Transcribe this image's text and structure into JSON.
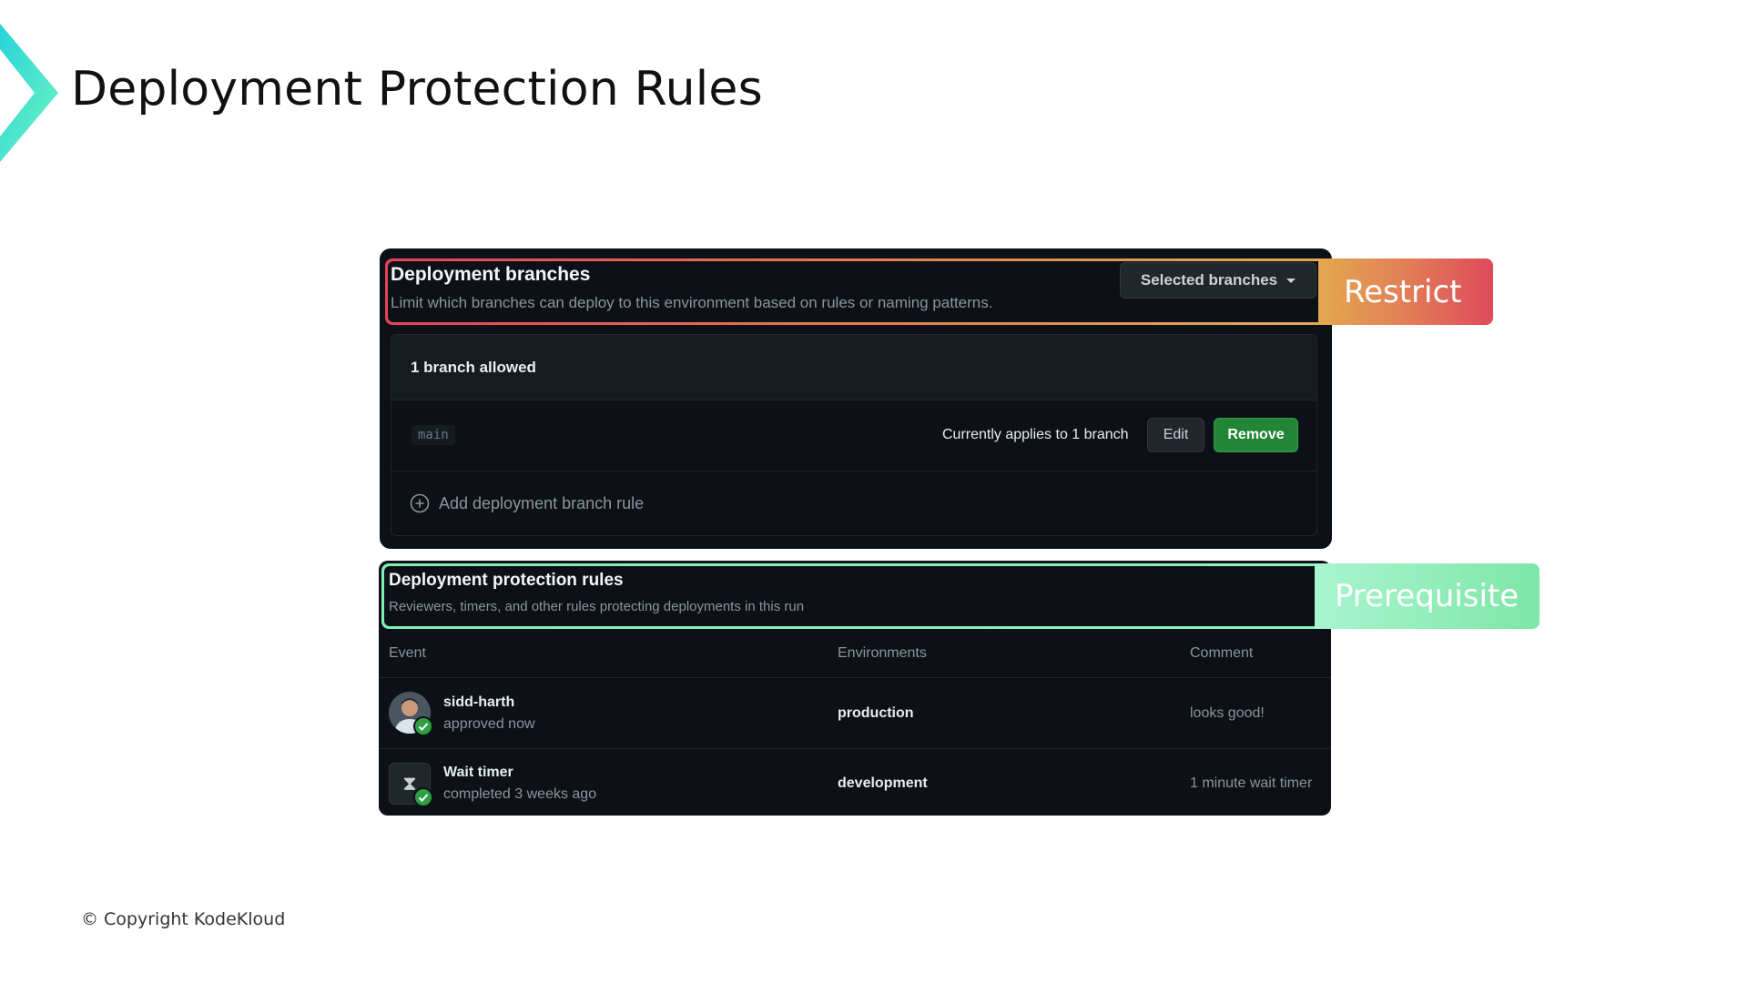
{
  "slide": {
    "title": "Deployment Protection Rules",
    "copyright": "© Copyright KodeKloud"
  },
  "colors": {
    "accent_teal": "#2ee6c8",
    "panel_bg": "#0d1117",
    "restrict_gradient_start": "#e3a84f",
    "restrict_gradient_end": "#de4a5c",
    "prerequisite_green": "#7ee6a6",
    "remove_button_green": "#238636"
  },
  "deployment_branches": {
    "title": "Deployment branches",
    "description": "Limit which branches can deploy to this environment based on rules or naming patterns.",
    "selector_label": "Selected branches",
    "annotation": "Restrict",
    "rules_header": "1 branch allowed",
    "rules": [
      {
        "branch": "main",
        "applies_text": "Currently applies to 1 branch",
        "edit_label": "Edit",
        "remove_label": "Remove"
      }
    ],
    "add_rule_label": "Add deployment branch rule"
  },
  "protection_rules": {
    "title": "Deployment protection rules",
    "description": "Reviewers, timers, and other rules protecting deployments in this run",
    "annotation": "Prerequisite",
    "columns": [
      "Event",
      "Environments",
      "Comment"
    ],
    "rows": [
      {
        "icon": "user-avatar",
        "name": "sidd-harth",
        "status": "approved now",
        "environment": "production",
        "comment": "looks good!"
      },
      {
        "icon": "hourglass-icon",
        "name": "Wait timer",
        "status": "completed 3 weeks ago",
        "environment": "development",
        "comment": "1 minute wait timer"
      }
    ]
  }
}
